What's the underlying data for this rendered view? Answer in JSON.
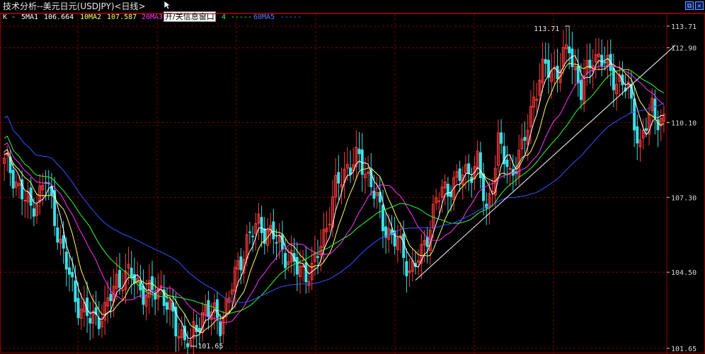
{
  "window": {
    "title": "技术分析--美元日元(USDJPY)<日线>",
    "info_toggle_label": "开/关信息窗口",
    "restore_glyph": "⧉",
    "close_glyph": "✕"
  },
  "legend": {
    "k_label": "K -",
    "ma1_label": "5MA1",
    "ma1_value": "106.664",
    "ma2_label": "10MA2",
    "ma2_value": "107.587",
    "ma3_label": "20MA3",
    "ma4_tail": "4",
    "ma4_dash": "-----",
    "ma5_label": "60MA5",
    "ma5_dash": "-----"
  },
  "colors": {
    "background": "#000000",
    "frame": "#8b0000",
    "grid": "#7a0000",
    "up_candle": "#ff3b3b",
    "down_candle": "#39e0e6",
    "ma5": "#ffffff",
    "ma10": "#ffff66",
    "ma20": "#ff33ff",
    "ma30": "#33ff33",
    "ma60": "#3355ff",
    "trendline": "#ffffff"
  },
  "chart_data": {
    "type": "candlestick",
    "title": "技术分析--美元日元(USDJPY)<日线>",
    "y_ticks": [
      "113.71",
      "112.90",
      "110.10",
      "107.30",
      "104.50",
      "101.65"
    ],
    "ylim": [
      101.65,
      113.71
    ],
    "grid": true,
    "annotations": {
      "high": "113.71",
      "low": "101.65"
    },
    "keypoints": [
      {
        "i": 0,
        "v": 108.6
      },
      {
        "i": 4,
        "v": 107.9
      },
      {
        "i": 9,
        "v": 106.8
      },
      {
        "i": 14,
        "v": 108.0
      },
      {
        "i": 19,
        "v": 105.6
      },
      {
        "i": 24,
        "v": 103.5
      },
      {
        "i": 29,
        "v": 102.7
      },
      {
        "i": 34,
        "v": 103.0
      },
      {
        "i": 38,
        "v": 104.2
      },
      {
        "i": 43,
        "v": 104.4
      },
      {
        "i": 48,
        "v": 103.6
      },
      {
        "i": 53,
        "v": 103.9
      },
      {
        "i": 58,
        "v": 102.4
      },
      {
        "i": 63,
        "v": 101.9
      },
      {
        "i": 68,
        "v": 103.2
      },
      {
        "i": 73,
        "v": 102.6
      },
      {
        "i": 78,
        "v": 104.3
      },
      {
        "i": 82,
        "v": 105.7
      },
      {
        "i": 86,
        "v": 106.3
      },
      {
        "i": 91,
        "v": 105.8
      },
      {
        "i": 95,
        "v": 105.2
      },
      {
        "i": 99,
        "v": 104.6
      },
      {
        "i": 104,
        "v": 104.5
      },
      {
        "i": 108,
        "v": 105.9
      },
      {
        "i": 112,
        "v": 107.6
      },
      {
        "i": 116,
        "v": 108.5
      },
      {
        "i": 120,
        "v": 108.7
      },
      {
        "i": 124,
        "v": 107.9
      },
      {
        "i": 128,
        "v": 106.3
      },
      {
        "i": 133,
        "v": 105.6
      },
      {
        "i": 137,
        "v": 104.6
      },
      {
        "i": 141,
        "v": 105.1
      },
      {
        "i": 146,
        "v": 107.2
      },
      {
        "i": 151,
        "v": 107.8
      },
      {
        "i": 156,
        "v": 108.2
      },
      {
        "i": 160,
        "v": 108.6
      },
      {
        "i": 163,
        "v": 106.7
      },
      {
        "i": 167,
        "v": 109.3
      },
      {
        "i": 171,
        "v": 108.2
      },
      {
        "i": 175,
        "v": 109.0
      },
      {
        "i": 179,
        "v": 111.1
      },
      {
        "i": 183,
        "v": 112.2
      },
      {
        "i": 187,
        "v": 112.0
      },
      {
        "i": 191,
        "v": 112.9
      },
      {
        "i": 195,
        "v": 111.2
      },
      {
        "i": 199,
        "v": 112.7
      },
      {
        "i": 203,
        "v": 112.3
      },
      {
        "i": 207,
        "v": 111.7
      },
      {
        "i": 211,
        "v": 111.3
      },
      {
        "i": 215,
        "v": 109.2
      },
      {
        "i": 219,
        "v": 110.7
      },
      {
        "i": 223,
        "v": 110.0
      }
    ],
    "candle_count": 224,
    "trendline": {
      "from": {
        "i": 139,
        "v": 104.2
      },
      "to": {
        "i": 224,
        "v": 113.0
      }
    },
    "series": [
      {
        "name": "5MA1",
        "period": 5
      },
      {
        "name": "10MA2",
        "period": 10
      },
      {
        "name": "20MA3",
        "period": 20
      },
      {
        "name": "",
        "period": 30
      },
      {
        "name": "60MA5",
        "period": 60
      }
    ]
  }
}
